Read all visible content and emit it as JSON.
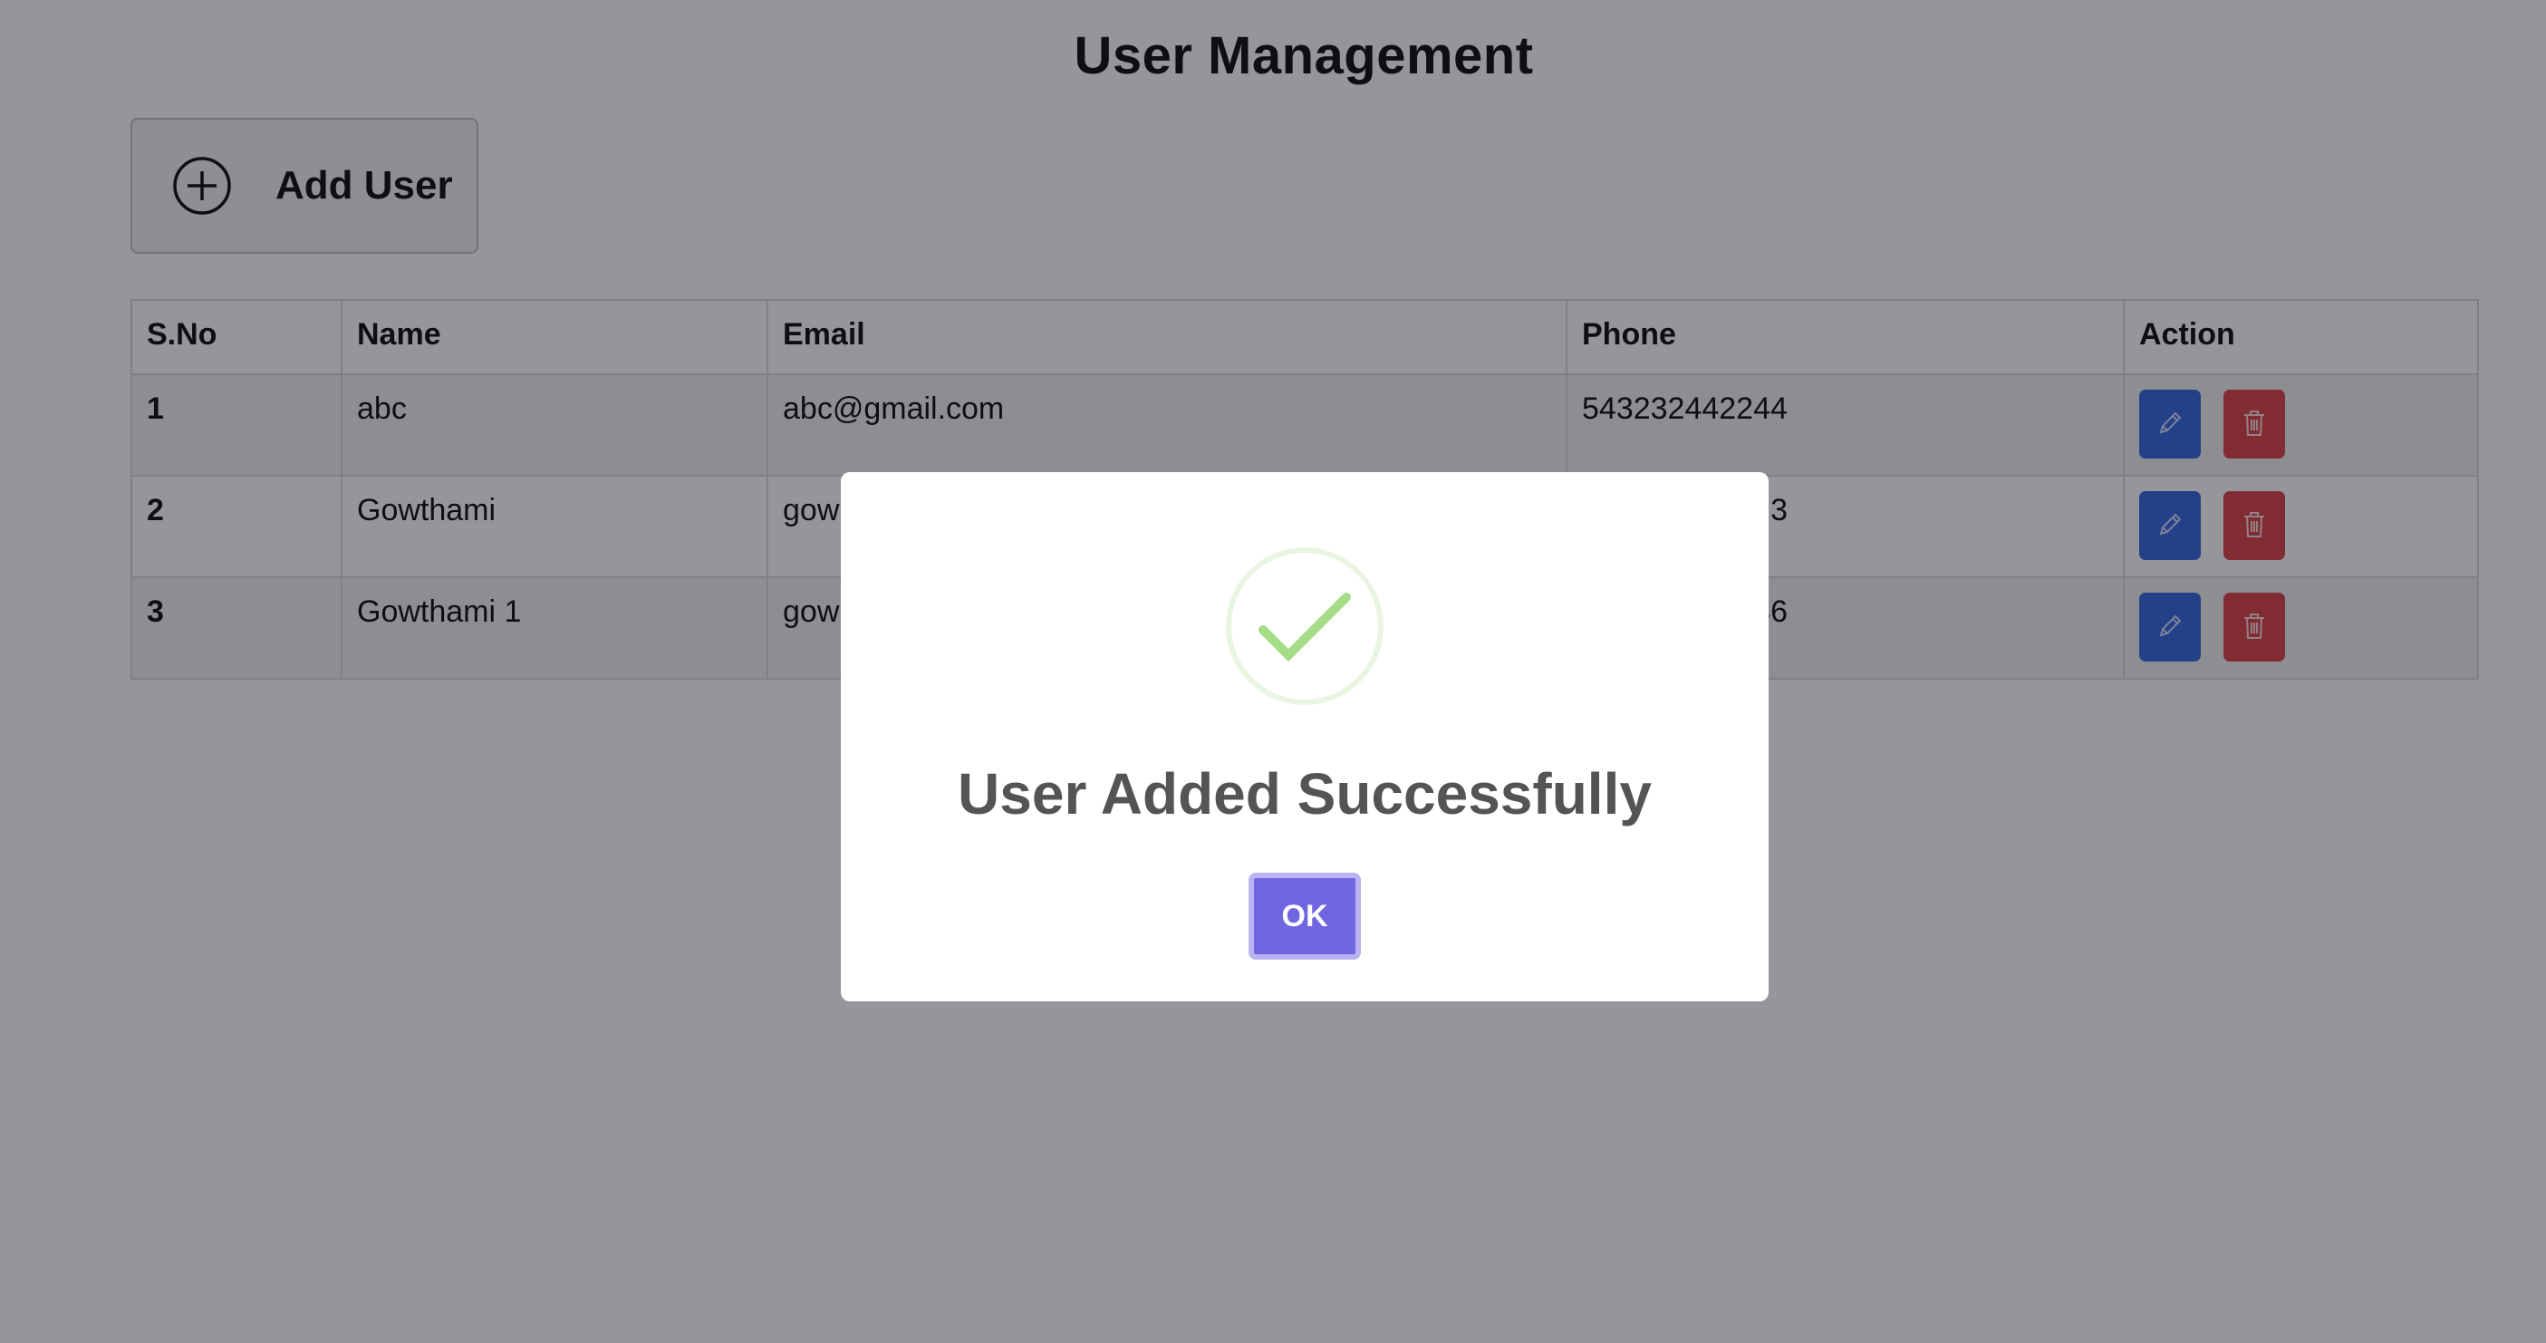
{
  "page": {
    "title": "User Management"
  },
  "toolbar": {
    "add_user_label": "Add User",
    "add_user_icon": "plus-circle-icon"
  },
  "table": {
    "columns": [
      "S.No",
      "Name",
      "Email",
      "Phone",
      "Action"
    ],
    "rows": [
      {
        "sno": "1",
        "name": "abc",
        "email": "abc@gmail.com",
        "phone": "543232442244"
      },
      {
        "sno": "2",
        "name": "Gowthami",
        "email": "gow",
        "phone": "3"
      },
      {
        "sno": "3",
        "name": "Gowthami 1",
        "email": "gow",
        "phone": "36"
      }
    ],
    "row_actions": [
      {
        "name": "edit",
        "icon": "pencil-icon",
        "color": "#2a5ddf"
      },
      {
        "name": "delete",
        "icon": "trash-icon",
        "color": "#d9363e"
      }
    ]
  },
  "modal": {
    "icon": "checkmark-icon",
    "icon_color": "#a5dc86",
    "title": "User Added Successfully",
    "ok_label": "OK",
    "ok_color": "#7066e0"
  }
}
